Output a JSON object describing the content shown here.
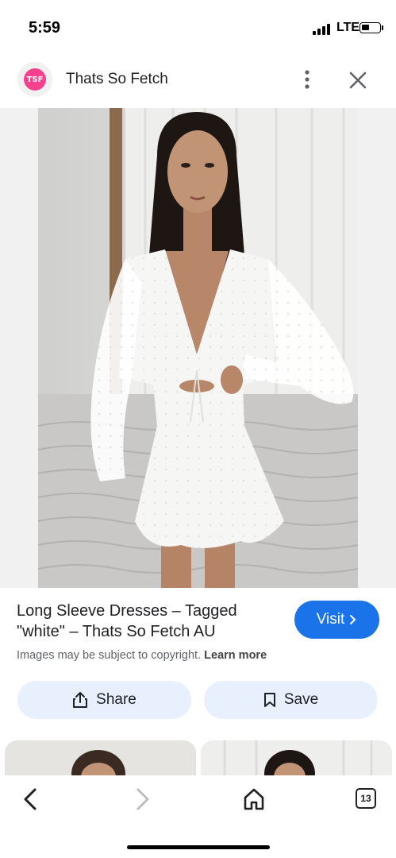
{
  "status_bar": {
    "time": "5:59",
    "network": "LTE",
    "battery_level": 0.3
  },
  "header": {
    "logo_text": "TSF",
    "site_name": "Thats So Fetch"
  },
  "result": {
    "title": "Long Sleeve Dresses – Tagged \"white\" – Thats So Fetch AU",
    "visit_label": "Visit",
    "copyright_text": "Images may be subject to copyright.",
    "learn_more_label": "Learn more"
  },
  "actions": {
    "share_label": "Share",
    "save_label": "Save"
  },
  "toolbar": {
    "tab_count": "13"
  },
  "colors": {
    "accent": "#1a73e8",
    "pill": "#e8f0fe",
    "logo": "#f7418f"
  }
}
